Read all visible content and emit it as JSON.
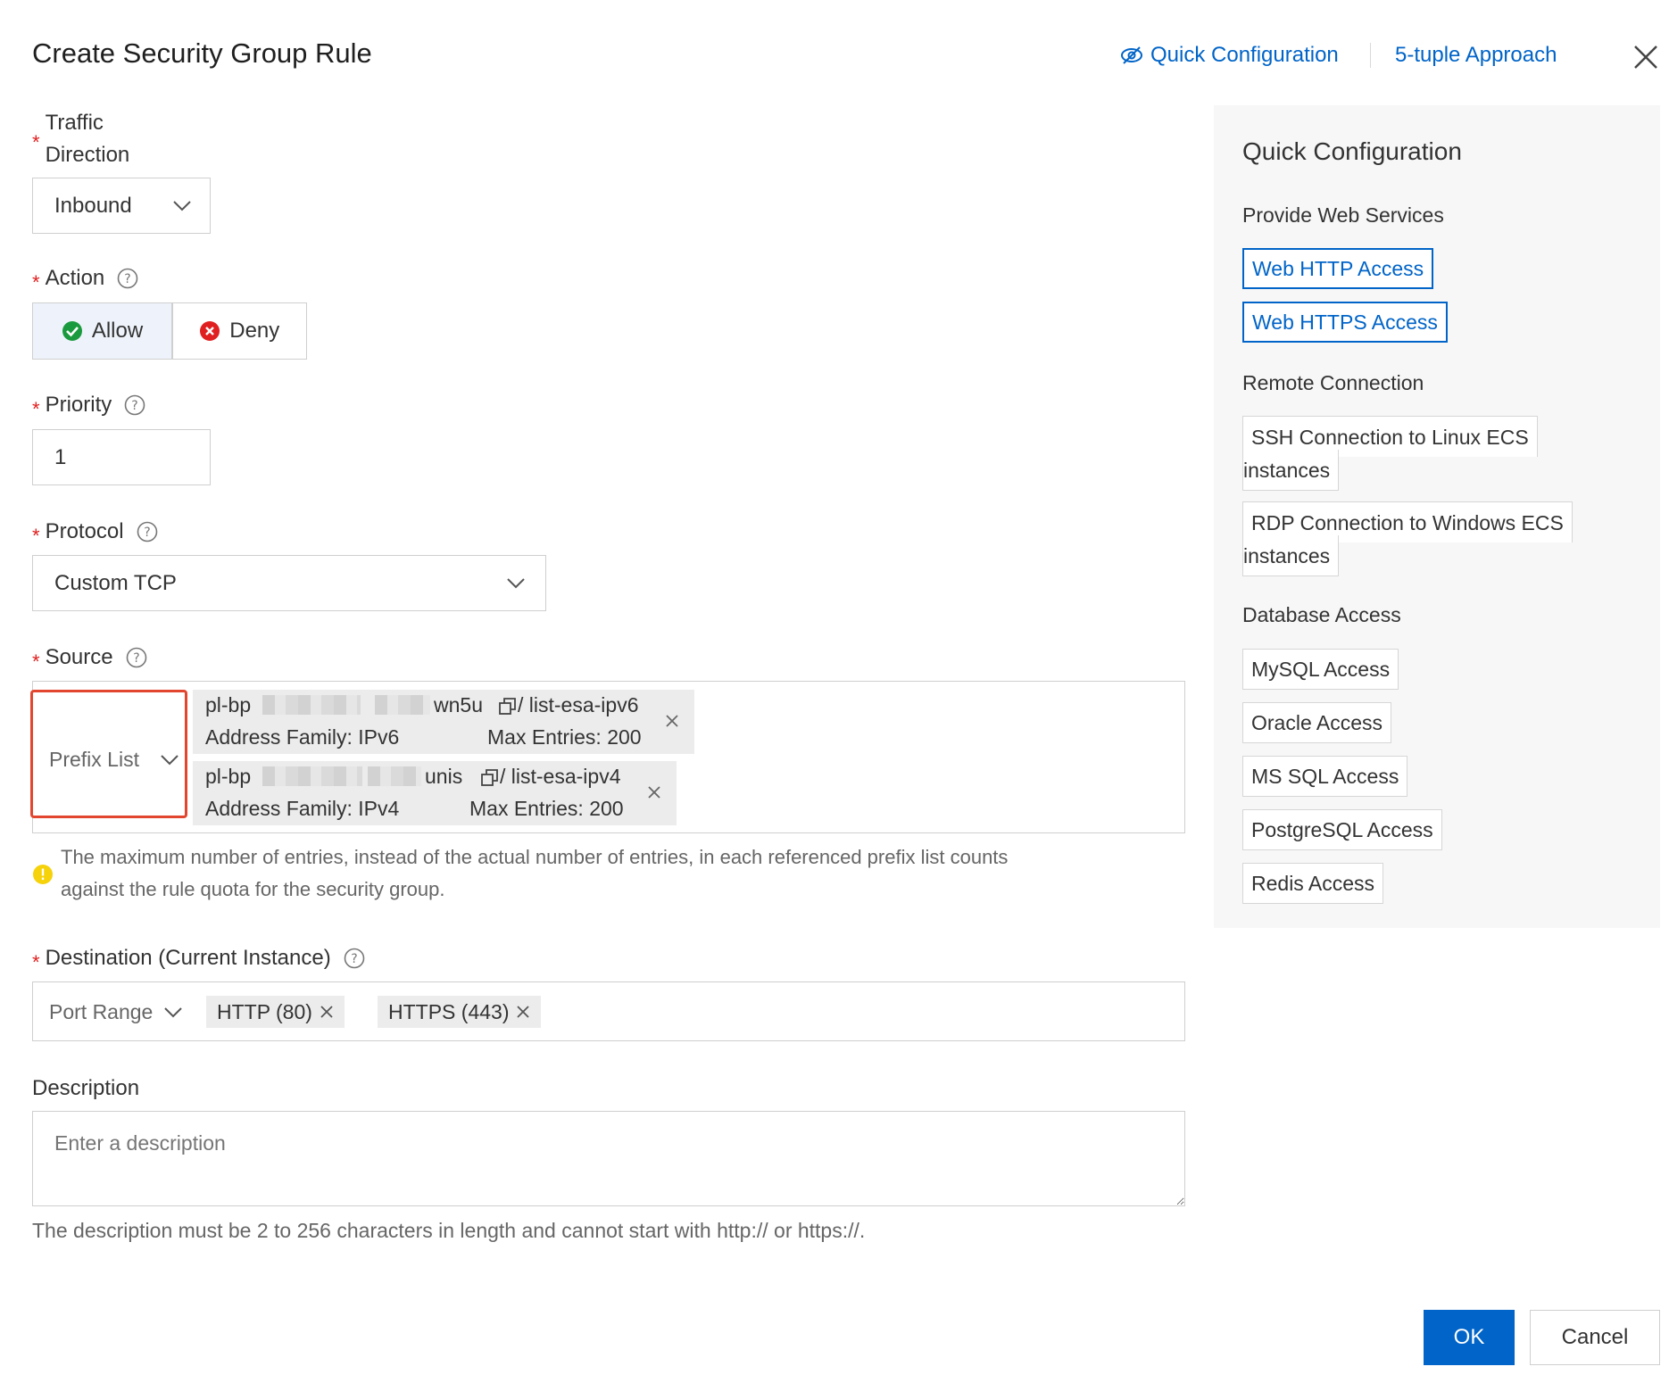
{
  "dialog": {
    "title": "Create Security Group Rule",
    "quick_config_link": "Quick Configuration",
    "five_tuple_link": "5-tuple Approach"
  },
  "traffic_direction": {
    "label_line1": "Traffic",
    "label_line2": "Direction",
    "value": "Inbound"
  },
  "action": {
    "label": "Action",
    "allow_label": "Allow",
    "deny_label": "Deny",
    "selected": "Allow"
  },
  "priority": {
    "label": "Priority",
    "value": "1"
  },
  "protocol": {
    "label": "Protocol",
    "value": "Custom TCP"
  },
  "source": {
    "label": "Source",
    "type": "Prefix List",
    "prefix_lists": [
      {
        "id_start": "pl-bp",
        "id_end": "wn5u",
        "name": "/ list-esa-ipv6",
        "family": "Address Family: IPv6",
        "max_entries": "Max Entries: 200"
      },
      {
        "id_start": "pl-bp",
        "id_end": "unis",
        "name": "/ list-esa-ipv4",
        "family": "Address Family: IPv4",
        "max_entries": "Max Entries: 200"
      }
    ],
    "warning_line1": "The maximum number of entries, instead of the actual number of entries, in each referenced prefix list counts",
    "warning_line2": "against the rule quota for the security group."
  },
  "destination": {
    "label": "Destination (Current Instance)",
    "type": "Port Range",
    "ports": [
      "HTTP (80)",
      "HTTPS (443)"
    ]
  },
  "description": {
    "label": "Description",
    "placeholder": "Enter a description",
    "value": "",
    "hint": "The description must be 2 to 256 characters in length and cannot start with http:// or https://."
  },
  "quick_panel": {
    "title": "Quick Configuration",
    "web_title": "Provide Web Services",
    "web_http": "Web HTTP Access",
    "web_https": "Web HTTPS Access",
    "remote_title": "Remote Connection",
    "ssh_line1": "SSH Connection to Linux ECS",
    "ssh_line2": "instances",
    "rdp_line1": "RDP Connection to Windows ECS",
    "rdp_line2": "instances",
    "db_title": "Database Access",
    "mysql": "MySQL Access",
    "oracle": "Oracle Access",
    "mssql": "MS SQL Access",
    "postgresql": "PostgreSQL Access",
    "redis": "Redis Access"
  },
  "footer": {
    "ok": "OK",
    "cancel": "Cancel"
  },
  "colors": {
    "primary": "#0064c8",
    "required": "#e02020",
    "allow": "#1a9a3e",
    "deny": "#e02020",
    "highlight_frame": "#e2462f",
    "warning": "#f5d20a"
  }
}
